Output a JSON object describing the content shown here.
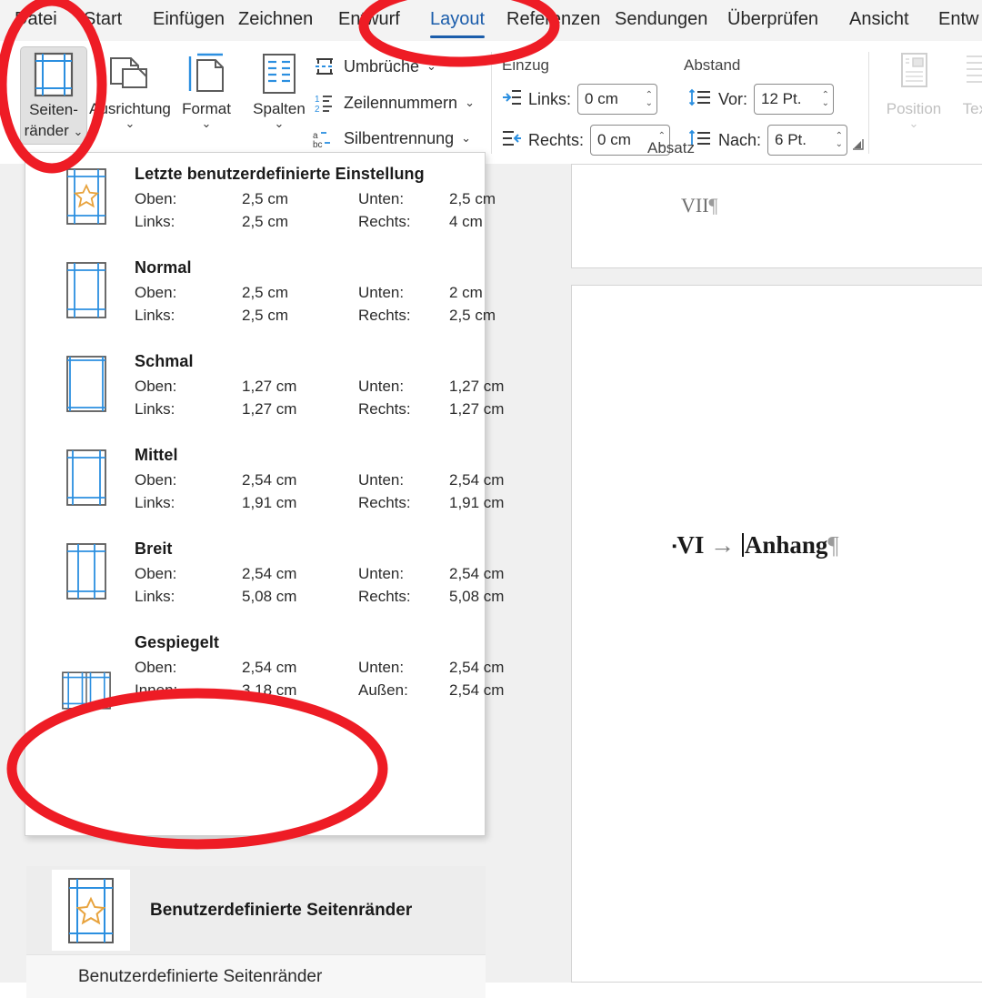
{
  "app": {
    "accent_color": "#1b5dab",
    "annotation_color": "#ee1c25"
  },
  "ribbon": {
    "tabs": [
      {
        "label": "Datei",
        "active": false
      },
      {
        "label": "Start",
        "active": false
      },
      {
        "label": "Einfügen",
        "active": false
      },
      {
        "label": "Zeichnen",
        "active": false
      },
      {
        "label": "Entwurf",
        "active": false
      },
      {
        "label": "Layout",
        "active": true
      },
      {
        "label": "Referenzen",
        "active": false
      },
      {
        "label": "Sendungen",
        "active": false
      },
      {
        "label": "Überprüfen",
        "active": false
      },
      {
        "label": "Ansicht",
        "active": false
      },
      {
        "label": "Entw",
        "active": false
      }
    ],
    "page_setup": {
      "buttons": [
        {
          "label_line1": "Seiten-",
          "label_line2": "ränder",
          "has_chevron": true,
          "selected": true
        },
        {
          "label_line1": "Ausrichtung",
          "label_line2": "",
          "has_chevron": true,
          "selected": false
        },
        {
          "label_line1": "Format",
          "label_line2": "",
          "has_chevron": true,
          "selected": false
        },
        {
          "label_line1": "Spalten",
          "label_line2": "",
          "has_chevron": true,
          "selected": false
        }
      ],
      "commands": [
        {
          "label": "Umbrüche",
          "chevron": "⌄"
        },
        {
          "label": "Zeilennummern",
          "chevron": "⌄"
        },
        {
          "label": "Silbentrennung",
          "chevron": "⌄"
        }
      ]
    },
    "paragraph": {
      "group_label": "Absatz",
      "indent_label": "Einzug",
      "spacing_label": "Abstand",
      "fields": [
        {
          "label": "Links:",
          "value": "0 cm"
        },
        {
          "label": "Rechts:",
          "value": "0 cm"
        },
        {
          "label": "Vor:",
          "value": "12 Pt."
        },
        {
          "label": "Nach:",
          "value": "6 Pt."
        }
      ]
    },
    "arrange": {
      "position_label": "Position",
      "wrap_label": "Textu"
    }
  },
  "margins_gallery": {
    "items": [
      {
        "title": "Letzte benutzerdefinierte Einstellung",
        "labels": {
          "top": "Oben:",
          "bottom": "Unten:",
          "left": "Links:",
          "right": "Rechts:"
        },
        "values": {
          "top": "2,5 cm",
          "bottom": "2,5 cm",
          "left": "2,5 cm",
          "right": "4 cm"
        },
        "thumb": "custom-star"
      },
      {
        "title": "Normal",
        "labels": {
          "top": "Oben:",
          "bottom": "Unten:",
          "left": "Links:",
          "right": "Rechts:"
        },
        "values": {
          "top": "2,5 cm",
          "bottom": "2 cm",
          "left": "2,5 cm",
          "right": "2,5 cm"
        },
        "thumb": "normal"
      },
      {
        "title": "Schmal",
        "labels": {
          "top": "Oben:",
          "bottom": "Unten:",
          "left": "Links:",
          "right": "Rechts:"
        },
        "values": {
          "top": "1,27 cm",
          "bottom": "1,27 cm",
          "left": "1,27 cm",
          "right": "1,27 cm"
        },
        "thumb": "narrow"
      },
      {
        "title": "Mittel",
        "labels": {
          "top": "Oben:",
          "bottom": "Unten:",
          "left": "Links:",
          "right": "Rechts:"
        },
        "values": {
          "top": "2,54 cm",
          "bottom": "2,54 cm",
          "left": "1,91 cm",
          "right": "1,91 cm"
        },
        "thumb": "moderate"
      },
      {
        "title": "Breit",
        "labels": {
          "top": "Oben:",
          "bottom": "Unten:",
          "left": "Links:",
          "right": "Rechts:"
        },
        "values": {
          "top": "2,54 cm",
          "bottom": "2,54 cm",
          "left": "5,08 cm",
          "right": "5,08 cm"
        },
        "thumb": "wide"
      },
      {
        "title": "Gespiegelt",
        "labels": {
          "top": "Oben:",
          "bottom": "Unten:",
          "left": "Innen:",
          "right": "Außen:"
        },
        "values": {
          "top": "2,54 cm",
          "bottom": "2,54 cm",
          "left": "3,18 cm",
          "right": "2,54 cm"
        },
        "thumb": "mirrored"
      }
    ],
    "custom_item_label": "Benutzerdefinierte Seitenränder",
    "status_text": "Benutzerdefinierte Seitenränder"
  },
  "document": {
    "page_number": "VII",
    "heading_bullet": "▪",
    "heading_number": "VI",
    "heading_tab": "→",
    "heading_text": "Anhang",
    "pilcrow": "¶"
  }
}
